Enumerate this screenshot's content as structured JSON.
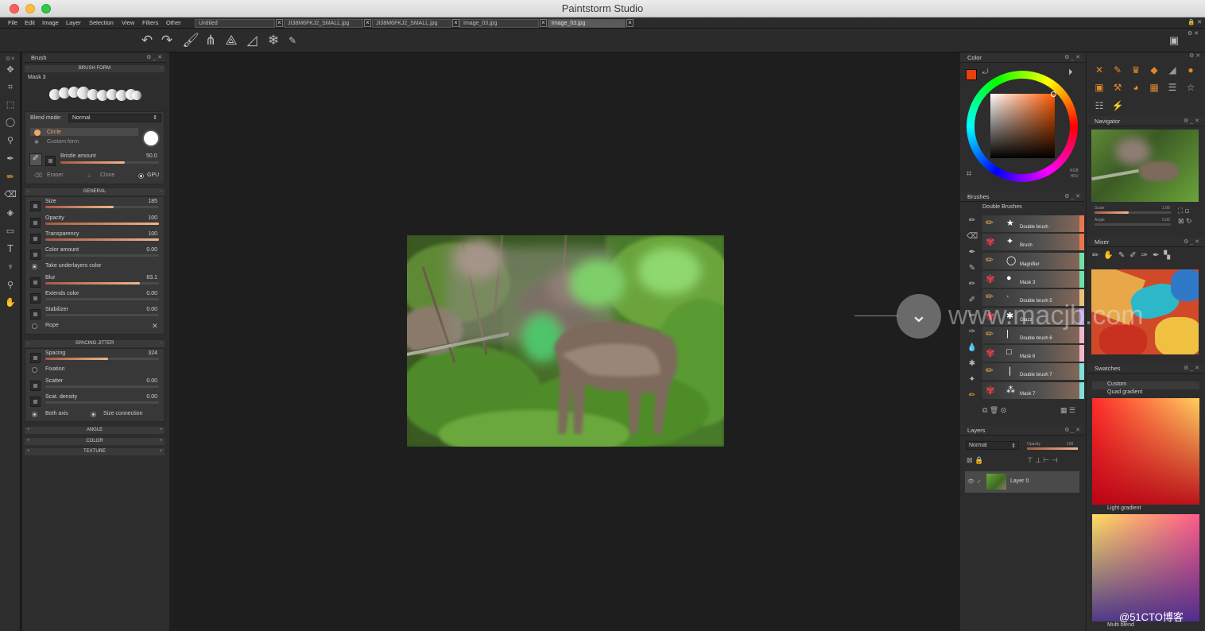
{
  "app": {
    "title": "Paintstorm Studio"
  },
  "menu": [
    "File",
    "Edit",
    "Image",
    "Layer",
    "Selection",
    "View",
    "Filters",
    "Other"
  ],
  "tabs": [
    "Untitled",
    "JI38M6FKJ2_SMALL.jpg",
    "JI38M6FKJ2_SMALL.jpg",
    "Image_03.jpg",
    "Image_03.jpg"
  ],
  "brush_panel": {
    "title": "Brush",
    "brush_form_header": "BRUSH FORM",
    "mask_name": "Mask 3",
    "blend_mode_label": "Blend mode:",
    "blend_mode_value": "Normal",
    "form_circle": "Circle",
    "form_custom": "Custom form",
    "bristle_label": "Bristle amount",
    "bristle_value": "50.0",
    "eraser": "Eraser",
    "clone": "Clone",
    "gpu": "GPU",
    "general_header": "GENERAL",
    "params": [
      {
        "label": "Size",
        "value": "185",
        "fill": 0.6
      },
      {
        "label": "Opacity",
        "value": "100",
        "fill": 1.0
      },
      {
        "label": "Transparency",
        "value": "100",
        "fill": 1.0
      },
      {
        "label": "Color amount",
        "value": "0.00",
        "fill": 0.0
      }
    ],
    "take_underlayers": "Take underlayers color",
    "params2": [
      {
        "label": "Blur",
        "value": "83.1",
        "fill": 0.83
      },
      {
        "label": "Extends color",
        "value": "0.00",
        "fill": 0.0
      },
      {
        "label": "Stabilizer",
        "value": "0.00",
        "fill": 0.0
      }
    ],
    "rope": "Rope",
    "spacing_header": "SPACING JITTER",
    "spacing": {
      "label": "Spacing",
      "value": "324",
      "fill": 0.55
    },
    "fixation": "Fixation",
    "params3": [
      {
        "label": "Scatter",
        "value": "0.00",
        "fill": 0.0
      },
      {
        "label": "Scat. density",
        "value": "0.00",
        "fill": 0.0
      }
    ],
    "both_axis": "Both axis",
    "size_connection": "Size connection",
    "angle_header": "ANGLE",
    "color_header": "COLOR",
    "texture_header": "TEXTURE"
  },
  "color_panel": {
    "title": "Color",
    "rgb": "RGB",
    "hsv": "HSV",
    "current_color": "#e8400c"
  },
  "brushes_panel": {
    "title": "Brushes",
    "set_name": "Double Brushes",
    "items": [
      {
        "name": "Double brush",
        "stripe": "#e8774e"
      },
      {
        "name": "Brush",
        "stripe": "#e8774e"
      },
      {
        "name": "Magnifier",
        "stripe": "#6ee0a8"
      },
      {
        "name": "Mask 3",
        "stripe": "#6ee0a8"
      },
      {
        "name": "Double brush 5",
        "stripe": "#e8c27a"
      },
      {
        "name": "Glazz",
        "stripe": "#b9a2e6"
      },
      {
        "name": "Double brush 6",
        "stripe": "#f2b6c8"
      },
      {
        "name": "Mask 6",
        "stripe": "#f2b6c8"
      },
      {
        "name": "Double brush 7",
        "stripe": "#7ee0d8"
      },
      {
        "name": "Mask 7",
        "stripe": "#7ee0d8"
      }
    ]
  },
  "layers_panel": {
    "title": "Layers",
    "blend": "Normal",
    "opacity_label": "Opacity",
    "opacity_value": "100",
    "layer_name": "Layer 0"
  },
  "navigator": {
    "title": "Navigator",
    "scale_label": "Scale",
    "scale_value": "1.00",
    "angle_label": "Angle",
    "angle_value": "0.00"
  },
  "mixer": {
    "title": "Mixer"
  },
  "swatches": {
    "title": "Swatches",
    "custom": "Custom",
    "quad": "Quad gradient",
    "light": "Light gradient",
    "multi": "Multi blend"
  },
  "watermark": {
    "text": "www.macjb.com",
    "credit": "@51CTO博客"
  }
}
